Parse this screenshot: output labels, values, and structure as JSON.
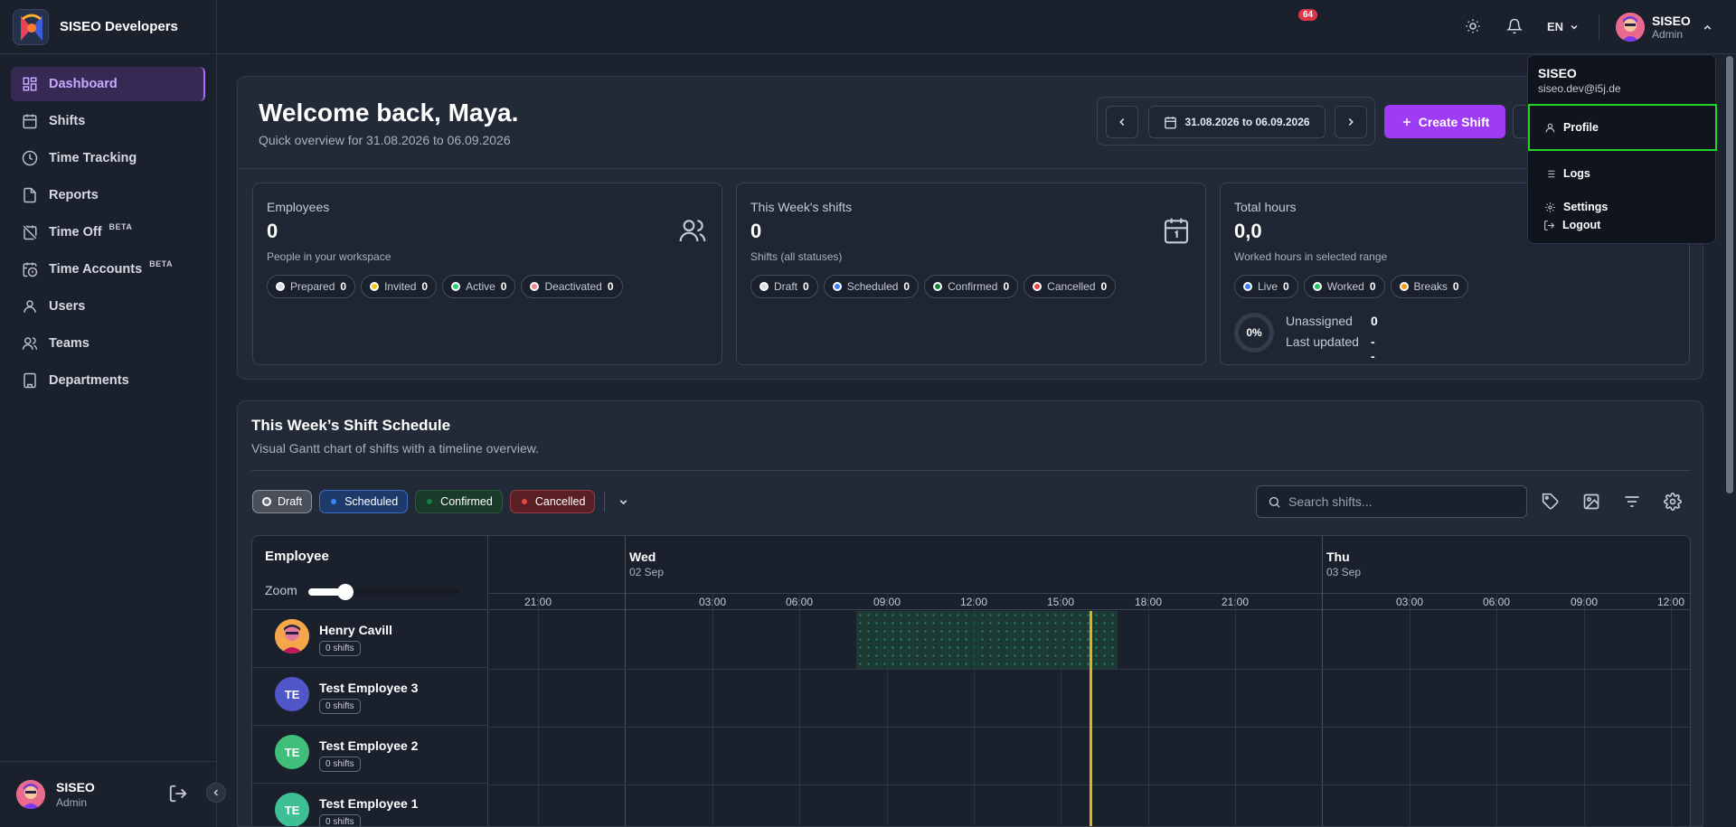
{
  "brand": {
    "name": "SISEO Developers"
  },
  "sidebar": {
    "items": [
      {
        "label": "Dashboard",
        "icon": "dashboard-icon"
      },
      {
        "label": "Shifts",
        "icon": "calendar-icon"
      },
      {
        "label": "Time Tracking",
        "icon": "clock-icon"
      },
      {
        "label": "Reports",
        "icon": "file-icon"
      },
      {
        "label": "Time Off",
        "beta": "BETA",
        "icon": "calendar-off-icon"
      },
      {
        "label": "Time Accounts",
        "beta": "BETA",
        "icon": "calendar-clock-icon"
      },
      {
        "label": "Users",
        "icon": "user-icon"
      },
      {
        "label": "Teams",
        "icon": "users-icon"
      },
      {
        "label": "Departments",
        "icon": "building-icon"
      }
    ],
    "user": {
      "name": "SISEO",
      "role": "Admin"
    }
  },
  "topbar": {
    "notifications": "64",
    "language": "EN",
    "user": {
      "name": "SISEO",
      "role": "Admin"
    }
  },
  "dropdown": {
    "name": "SISEO",
    "email": "siseo.dev@i5j.de",
    "items": [
      "Profile",
      "Logs",
      "Settings",
      "Logout"
    ]
  },
  "hero": {
    "welcome": "Welcome back, Maya.",
    "overview": "Quick overview for 31.08.2026 to 06.09.2026",
    "date_range": "31.08.2026 to 06.09.2026",
    "create_label": "Create Shift"
  },
  "stats": {
    "employees": {
      "label": "Employees",
      "value": "0",
      "sub": "People in your workspace",
      "chips": [
        {
          "label": "Prepared",
          "count": "0",
          "color": "#d9dce3"
        },
        {
          "label": "Invited",
          "count": "0",
          "color": "#f2c811"
        },
        {
          "label": "Active",
          "count": "0",
          "color": "#2ecc71"
        },
        {
          "label": "Deactivated",
          "count": "0",
          "color": "#f08a8a"
        }
      ]
    },
    "shifts": {
      "label": "This Week's shifts",
      "value": "0",
      "sub": "Shifts (all statuses)",
      "chips": [
        {
          "label": "Draft",
          "count": "0",
          "color": "#d9dce3"
        },
        {
          "label": "Scheduled",
          "count": "0",
          "color": "#3b82f6"
        },
        {
          "label": "Confirmed",
          "count": "0",
          "color": "#15803d"
        },
        {
          "label": "Cancelled",
          "count": "0",
          "color": "#ef4444"
        }
      ]
    },
    "hours": {
      "label": "Total hours",
      "value": "0,0",
      "sub": "Worked hours in selected range",
      "chips": [
        {
          "label": "Live",
          "count": "0",
          "color": "#3b82f6"
        },
        {
          "label": "Worked",
          "count": "0",
          "color": "#22c55e"
        },
        {
          "label": "Breaks",
          "count": "0",
          "color": "#f59e0b"
        }
      ],
      "ring": "0%",
      "unassigned_label": "Unassigned",
      "unassigned_value": "0",
      "updated_label": "Last updated",
      "updated_value": "--"
    }
  },
  "schedule": {
    "title": "This Week’s Shift Schedule",
    "subtitle": "Visual Gantt chart of shifts with a timeline overview.",
    "filters": [
      "Draft",
      "Scheduled",
      "Confirmed",
      "Cancelled"
    ],
    "search_placeholder": "Search shifts...",
    "employee_header": "Employee",
    "zoom_label": "Zoom",
    "days": [
      {
        "name": "Wed",
        "date": "02 Sep"
      },
      {
        "name": "Thu",
        "date": "03 Sep"
      }
    ],
    "hours": [
      "21:00",
      "03:00",
      "06:00",
      "09:00",
      "12:00",
      "15:00",
      "18:00",
      "21:00",
      "03:00",
      "06:00",
      "09:00",
      "12:00"
    ],
    "employees": [
      {
        "name": "Henry Cavill",
        "shifts": "0 shifts",
        "initials": ""
      },
      {
        "name": "Test Employee 3",
        "shifts": "0 shifts",
        "initials": "TE"
      },
      {
        "name": "Test Employee 2",
        "shifts": "0 shifts",
        "initials": "TE"
      },
      {
        "name": "Test Employee 1",
        "shifts": "0 shifts",
        "initials": "TE"
      }
    ]
  }
}
